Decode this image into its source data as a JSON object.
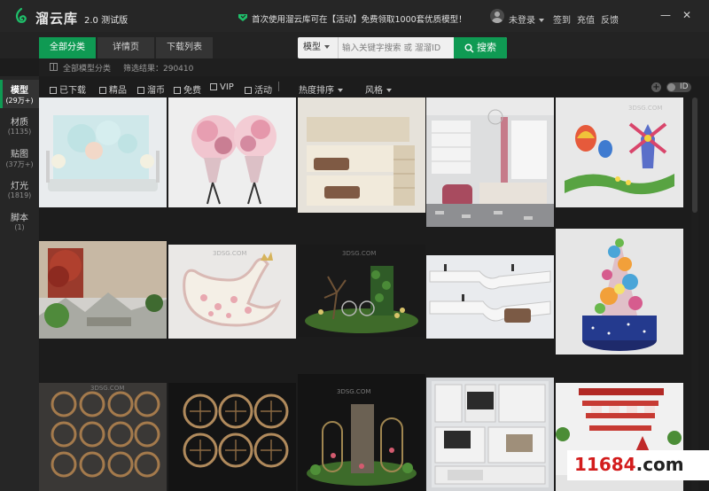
{
  "app": {
    "name": "溜云库",
    "version": "2.0 测试版",
    "notice": "首次使用溜云库可在【活动】免费领取1000套优质模型！",
    "user_login": "未登录",
    "links": [
      "签到",
      "充值",
      "反馈"
    ],
    "window_controls": [
      "minimize",
      "close"
    ]
  },
  "nav": {
    "tabs": [
      {
        "label": "全部分类",
        "active": true
      },
      {
        "label": "详情页",
        "active": false
      },
      {
        "label": "下载列表",
        "active": false
      }
    ],
    "search": {
      "type_label": "模型",
      "placeholder": "输入关键字搜索 或 溜溜ID",
      "button_label": "搜索"
    }
  },
  "breadcrumb": {
    "path": "全部模型分类",
    "result": "筛选结果：290410"
  },
  "sidebar": {
    "items": [
      {
        "name": "模型",
        "count": "(29万+)",
        "active": true
      },
      {
        "name": "材质",
        "count": "(1135)",
        "active": false
      },
      {
        "name": "贴图",
        "count": "(37万+)",
        "active": false
      },
      {
        "name": "灯光",
        "count": "(1819)",
        "active": false
      },
      {
        "name": "脚本",
        "count": "(1)",
        "active": false
      }
    ]
  },
  "filters": {
    "checkboxes": [
      "已下载",
      "精品",
      "溜币",
      "免费",
      "VIP",
      "活动"
    ],
    "sort_label": "热度排序",
    "style_label": "风格",
    "id_toggle_label": "ID"
  },
  "cards": [
    {
      "label": "3DSG.COM"
    },
    {
      "label": "3DSG.COM"
    },
    {
      "label": "3DSG.COM"
    },
    {
      "label": "3DSG.COM"
    }
  ],
  "colors": {
    "accent": "#0f9a53",
    "background": "#1c1c1c",
    "titlebar": "#262626"
  },
  "watermark": {
    "number": "11684",
    "domain": ".com"
  }
}
